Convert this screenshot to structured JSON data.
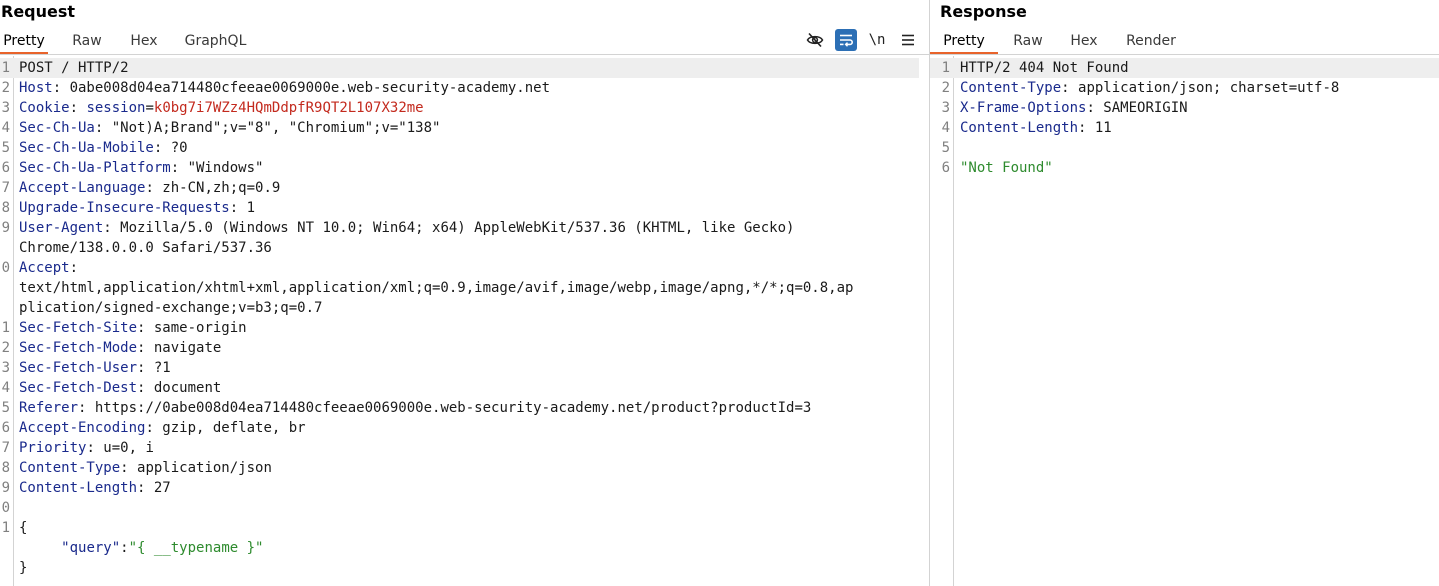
{
  "request": {
    "title": "Request",
    "tabs": [
      "Pretty",
      "Raw",
      "Hex",
      "GraphQL"
    ],
    "active_tab": "Pretty",
    "toolbar": {
      "hide_icon": "eye-slash-icon",
      "wrap_icon": "wrap-lines-icon",
      "newline_label": "\\n",
      "menu_icon": "hamburger-menu-icon"
    },
    "lines": [
      {
        "num": "1",
        "text": "POST / HTTP/2"
      },
      {
        "num": "2",
        "key": "Host",
        "value": "0abe008d04ea714480cfeeae0069000e.web-security-academy.net"
      },
      {
        "num": "3",
        "key": "Cookie",
        "cookie_name": "session",
        "cookie_value": "k0bg7i7WZz4HQmDdpfR9QT2L107X32me"
      },
      {
        "num": "4",
        "key": "Sec-Ch-Ua",
        "value": "\"Not)A;Brand\";v=\"8\", \"Chromium\";v=\"138\""
      },
      {
        "num": "5",
        "key": "Sec-Ch-Ua-Mobile",
        "value": "?0"
      },
      {
        "num": "6",
        "key": "Sec-Ch-Ua-Platform",
        "value": "\"Windows\""
      },
      {
        "num": "7",
        "key": "Accept-Language",
        "value": "zh-CN,zh;q=0.9"
      },
      {
        "num": "8",
        "key": "Upgrade-Insecure-Requests",
        "value": "1"
      },
      {
        "num": "9",
        "key": "User-Agent",
        "value": "Mozilla/5.0 (Windows NT 10.0; Win64; x64) AppleWebKit/537.36 (KHTML, like Gecko)"
      },
      {
        "num": "",
        "text": "Chrome/138.0.0.0 Safari/537.36"
      },
      {
        "num": "0",
        "key": "Accept",
        "value": ""
      },
      {
        "num": "",
        "text": "text/html,application/xhtml+xml,application/xml;q=0.9,image/avif,image/webp,image/apng,*/*;q=0.8,ap"
      },
      {
        "num": "",
        "text": "plication/signed-exchange;v=b3;q=0.7"
      },
      {
        "num": "1",
        "key": "Sec-Fetch-Site",
        "value": "same-origin"
      },
      {
        "num": "2",
        "key": "Sec-Fetch-Mode",
        "value": "navigate"
      },
      {
        "num": "3",
        "key": "Sec-Fetch-User",
        "value": "?1"
      },
      {
        "num": "4",
        "key": "Sec-Fetch-Dest",
        "value": "document"
      },
      {
        "num": "5",
        "key": "Referer",
        "value": "https://0abe008d04ea714480cfeeae0069000e.web-security-academy.net/product?productId=3"
      },
      {
        "num": "6",
        "key": "Accept-Encoding",
        "value": "gzip, deflate, br"
      },
      {
        "num": "7",
        "key": "Priority",
        "value": "u=0, i"
      },
      {
        "num": "8",
        "key": "Content-Type",
        "value": "application/json"
      },
      {
        "num": "9",
        "key": "Content-Length",
        "value": "27"
      },
      {
        "num": "0",
        "text": ""
      },
      {
        "num": "1",
        "text": "{"
      },
      {
        "num": "",
        "json_key": "\"query\"",
        "json_value": "\"{ __typename }\""
      },
      {
        "num": "",
        "text": "}"
      }
    ]
  },
  "response": {
    "title": "Response",
    "tabs": [
      "Pretty",
      "Raw",
      "Hex",
      "Render"
    ],
    "active_tab": "Pretty",
    "lines": [
      {
        "num": "1",
        "text": "HTTP/2 404 Not Found"
      },
      {
        "num": "2",
        "key": "Content-Type",
        "value": "application/json; charset=utf-8"
      },
      {
        "num": "3",
        "key": "X-Frame-Options",
        "value": "SAMEORIGIN"
      },
      {
        "num": "4",
        "key": "Content-Length",
        "value": "11"
      },
      {
        "num": "5",
        "text": ""
      },
      {
        "num": "6",
        "json_string": "\"Not Found\""
      }
    ]
  },
  "colors": {
    "accent_tab_underline": "#e8632b",
    "header_name": "#1a2a8c",
    "cookie_value": "#c32a1e",
    "json_string": "#2e8b2e",
    "wrap_toggle_bg": "#2c6fb5"
  }
}
